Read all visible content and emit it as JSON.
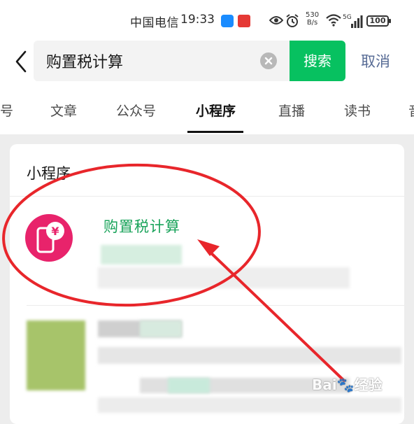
{
  "status_bar": {
    "carrier": "中国电信",
    "time": "19:33",
    "net_speed_value": "530",
    "net_speed_unit": "B/s",
    "signal_label": "5G",
    "battery": "100"
  },
  "search": {
    "query": "购置税计算",
    "button_label": "搜索",
    "cancel_label": "取消"
  },
  "tabs": [
    {
      "label": "号"
    },
    {
      "label": "文章"
    },
    {
      "label": "公众号"
    },
    {
      "label": "小程序"
    },
    {
      "label": "直播"
    },
    {
      "label": "读书"
    },
    {
      "label": "音"
    }
  ],
  "active_tab": "小程序",
  "results": {
    "section_title": "小程序",
    "items": [
      {
        "name": "购置税计算",
        "logo_icon": "yen-phone-icon"
      }
    ]
  },
  "watermark": "Bai🐾经验",
  "colors": {
    "accent_green": "#07c160",
    "link_blue": "#576b95",
    "result_green": "#19a35a",
    "logo_pink": "#e8236b",
    "annotation_red": "#e8262b"
  }
}
